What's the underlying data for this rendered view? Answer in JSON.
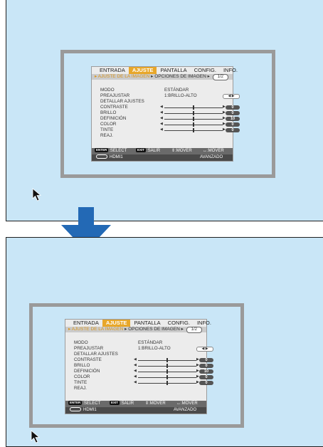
{
  "osd": {
    "tabs": [
      "ENTRADA",
      "AJUSTE",
      "PANTALLA",
      "CONFIG.",
      "INFO."
    ],
    "active_tab": "AJUSTE",
    "breadcrumb": {
      "active": "AJUSTE DE LA IMAGEN",
      "other": "OPCIONES DE IMAGEN",
      "page": "1/2"
    },
    "rows": {
      "modo": {
        "label": "MODO",
        "value": "ESTÁNDAR"
      },
      "preajustar": {
        "label": "PREAJUSTAR",
        "value": "1:BRILLO-ALTO",
        "selector": "◀ ▶"
      },
      "detallar": {
        "label": "DETALLAR AJUSTES"
      },
      "contraste": {
        "label": "CONTRASTE",
        "value": "0",
        "level": 0.5
      },
      "brillo": {
        "label": "BRILLO",
        "value": "0",
        "level": 0.5
      },
      "definicion": {
        "label": "DEFINICIÓN",
        "value": "10",
        "level": 0.5
      },
      "color": {
        "label": "COLOR",
        "value": "0",
        "level": 0.5
      },
      "tinte": {
        "label": "TINTE",
        "value": "0",
        "level": 0.5
      },
      "reaj": {
        "label": "REAJ."
      }
    },
    "footer": {
      "enter_key": "ENTER",
      "select": ":SELECT",
      "exit_key": "EXIT",
      "salir": ":SALIR",
      "mover_v": "⇕:MOVER",
      "mover_h": "↔:MOVER",
      "source": "HDMI1",
      "mode": "AVANZADO"
    }
  },
  "colors": {
    "screen_bg": "#c9e6f7",
    "frame": "#9a9a9a",
    "active_tab": "#e8a72a",
    "arrow": "#2369b5"
  },
  "icons": {
    "transition": "down-arrow-icon",
    "pointer": "mouse-pointer-icon"
  }
}
